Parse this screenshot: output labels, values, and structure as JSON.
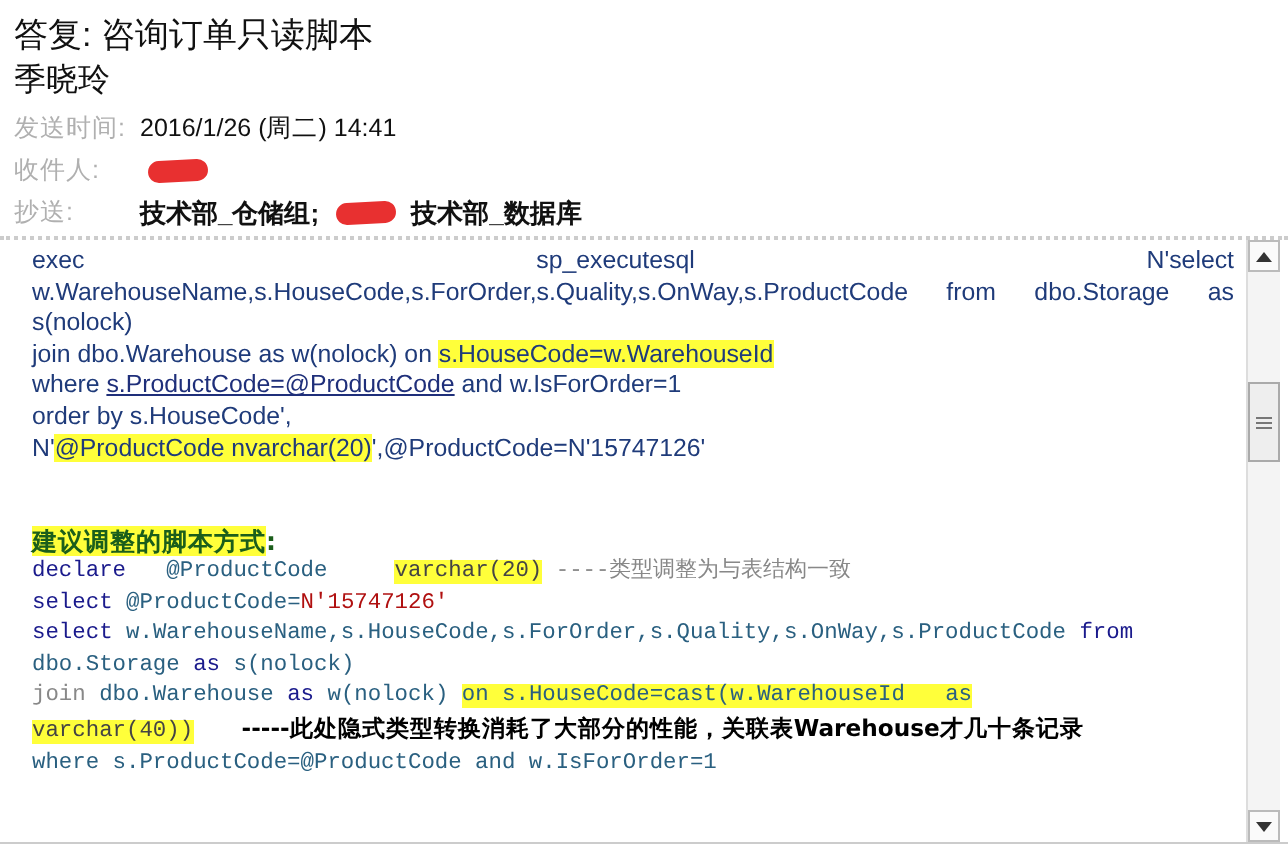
{
  "message": {
    "subject": "答复: 咨询订单只读脚本",
    "sender": "季晓玲",
    "fields": [
      {
        "label": "发送时间:",
        "parts": [
          {
            "kind": "text",
            "text": "2016/1/26 (周二) 14:41"
          }
        ]
      },
      {
        "label": "收件人:",
        "parts": [
          {
            "kind": "redaction"
          }
        ]
      },
      {
        "label": "抄送:",
        "parts": [
          {
            "kind": "strong",
            "text": "技术部_仓储组;"
          },
          {
            "kind": "redaction"
          },
          {
            "kind": "strong",
            "text": "技术部_数据库"
          }
        ]
      }
    ]
  },
  "body": {
    "lines": [
      {
        "kind": "prose",
        "justify": true,
        "segments": [
          {
            "text": "exec sp_executesql N'select",
            "kind": "plain",
            "highlight": false
          }
        ]
      },
      {
        "kind": "prose",
        "justify": true,
        "segments": [
          {
            "text": "w.WarehouseName,s.HouseCode,s.ForOrder,s.Quality,s.OnWay,s.ProductCode from dbo.Storage as",
            "kind": "plain",
            "highlight": false
          }
        ]
      },
      {
        "kind": "prose",
        "segments": [
          {
            "text": "s(nolock)",
            "kind": "plain",
            "highlight": false
          }
        ]
      },
      {
        "kind": "prose",
        "segments": [
          {
            "text": "join dbo.Warehouse as w(nolock) on ",
            "kind": "plain",
            "highlight": false
          },
          {
            "text": "s.HouseCode=w.WarehouseId",
            "kind": "plain",
            "highlight": true
          }
        ]
      },
      {
        "kind": "prose",
        "segments": [
          {
            "text": "where ",
            "kind": "plain",
            "highlight": false
          },
          {
            "text": "s.ProductCode=@ProductCode",
            "kind": "link",
            "highlight": false
          },
          {
            "text": " and w.IsForOrder=1",
            "kind": "plain",
            "highlight": false
          }
        ]
      },
      {
        "kind": "prose",
        "segments": [
          {
            "text": "order by s.HouseCode',",
            "kind": "plain",
            "highlight": false
          }
        ]
      },
      {
        "kind": "prose",
        "segments": [
          {
            "text": "N'",
            "kind": "plain",
            "highlight": false
          },
          {
            "text": "@ProductCode nvarchar(20)",
            "kind": "plain",
            "highlight": true
          },
          {
            "text": "',@ProductCode=N'15747126'",
            "kind": "plain",
            "highlight": false
          }
        ]
      },
      {
        "kind": "blank"
      },
      {
        "kind": "blank"
      },
      {
        "kind": "heading",
        "segments": [
          {
            "text": "建议调整的脚本方式",
            "kind": "heading",
            "highlight": true
          },
          {
            "text": ":",
            "kind": "heading",
            "highlight": false
          }
        ]
      },
      {
        "kind": "code",
        "segments": [
          {
            "text": "declare",
            "kind": "keyword",
            "highlight": false
          },
          {
            "text": "   @ProductCode     ",
            "kind": "ident",
            "highlight": false
          },
          {
            "text": "varchar(20)",
            "kind": "type",
            "highlight": true
          },
          {
            "text": " ----类型调整为与表结构一致",
            "kind": "comment",
            "highlight": false
          }
        ]
      },
      {
        "kind": "code",
        "segments": [
          {
            "text": "select",
            "kind": "keyword",
            "highlight": false
          },
          {
            "text": " @ProductCode=",
            "kind": "ident",
            "highlight": false
          },
          {
            "text": "N'15747126'",
            "kind": "string",
            "highlight": false
          }
        ]
      },
      {
        "kind": "code",
        "segments": [
          {
            "text": "select",
            "kind": "keyword",
            "highlight": false
          },
          {
            "text": " w.WarehouseName,s.HouseCode,s.ForOrder,s.Quality,s.OnWay,s.ProductCode ",
            "kind": "ident",
            "highlight": false
          },
          {
            "text": "from",
            "kind": "keyword",
            "highlight": false
          }
        ]
      },
      {
        "kind": "code",
        "segments": [
          {
            "text": "dbo.Storage ",
            "kind": "ident",
            "highlight": false
          },
          {
            "text": "as",
            "kind": "keyword",
            "highlight": false
          },
          {
            "text": " s(nolock)",
            "kind": "ident",
            "highlight": false
          }
        ]
      },
      {
        "kind": "code",
        "segments": [
          {
            "text": "join",
            "kind": "comment",
            "highlight": false
          },
          {
            "text": " dbo.Warehouse ",
            "kind": "ident",
            "highlight": false
          },
          {
            "text": "as",
            "kind": "keyword",
            "highlight": false
          },
          {
            "text": " w(nolock) ",
            "kind": "ident",
            "highlight": false
          },
          {
            "text": "on s.HouseCode=cast(w.WarehouseId   as",
            "kind": "ident",
            "highlight": true
          }
        ]
      },
      {
        "kind": "code",
        "segments": [
          {
            "text": "varchar(40))",
            "kind": "type",
            "highlight": true
          },
          {
            "text": "      -----此处隐式类型转换消耗了大部分的性能，关联表Warehouse才几十条记录",
            "kind": "note",
            "highlight": false
          }
        ]
      },
      {
        "kind": "code",
        "segments": [
          {
            "text": "where s.ProductCode=@ProductCode and w.IsForOrder=1",
            "kind": "ident",
            "highlight": false
          }
        ]
      }
    ]
  }
}
